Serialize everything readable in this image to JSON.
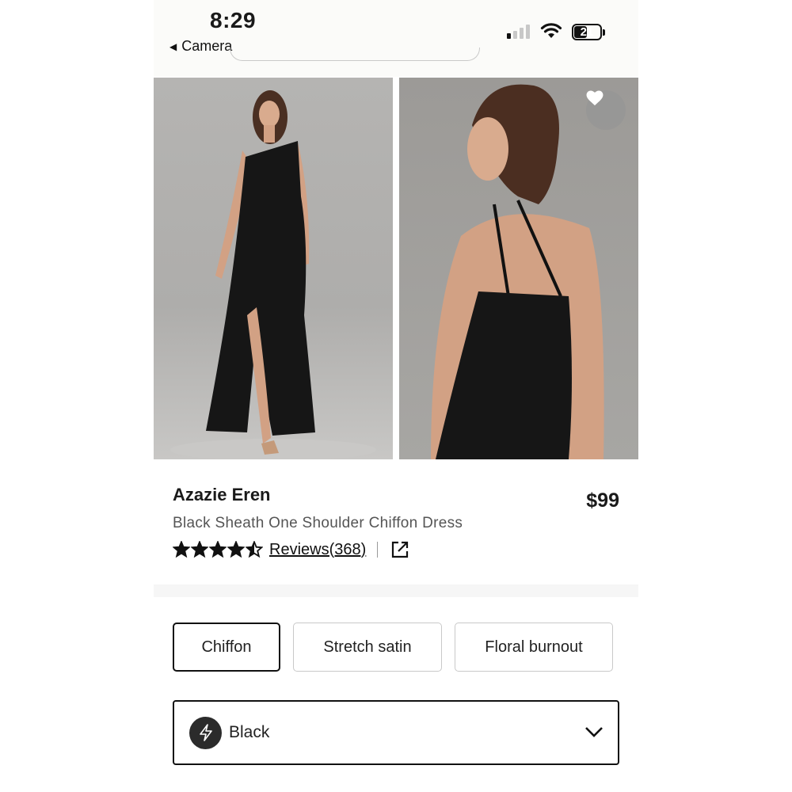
{
  "status_bar": {
    "time": "8:29",
    "back_label": "Camera",
    "battery": "21"
  },
  "product": {
    "brand": "Azazie Eren",
    "price": "$99",
    "subtitle": "Black Sheath One Shoulder Chiffon Dress",
    "rating": 4.5,
    "reviews_label": "Reviews(368)"
  },
  "fabrics": [
    {
      "label": "Chiffon",
      "selected": true
    },
    {
      "label": "Stretch satin",
      "selected": false
    },
    {
      "label": "Floral burnout",
      "selected": false
    }
  ],
  "color_select": {
    "value": "Black",
    "swatch_color": "#2b2b2b"
  },
  "icons": {
    "favorite": "heart-icon",
    "share": "external-link-icon",
    "dropdown": "chevron-down-icon",
    "swatch": "lightning-icon"
  }
}
